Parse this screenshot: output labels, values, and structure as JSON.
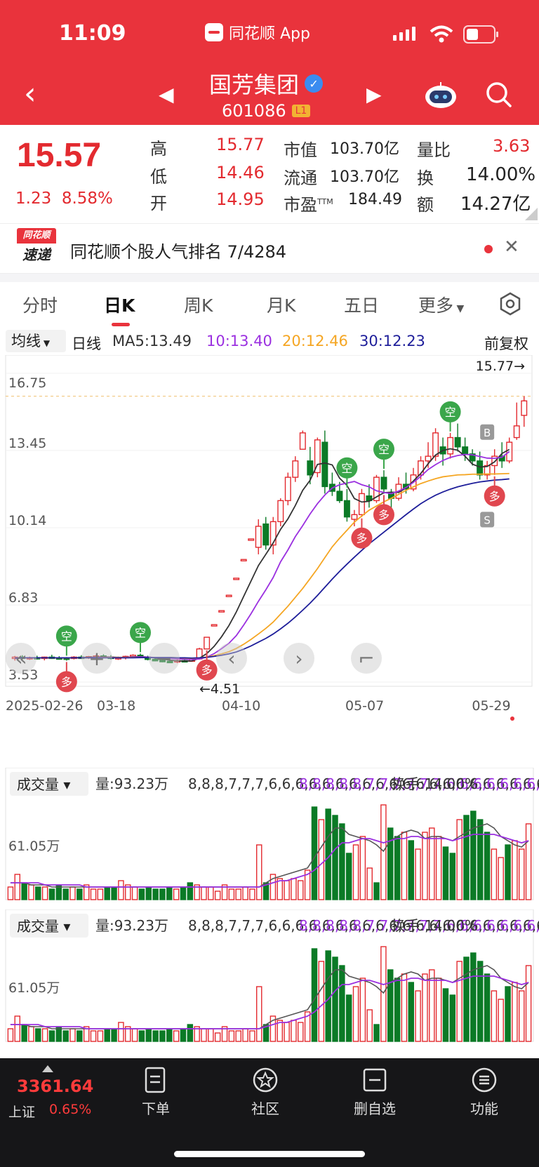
{
  "status_bar": {
    "time": "11:09",
    "app_name": "同花顺 App"
  },
  "header": {
    "stock_name": "国芳集团",
    "stock_code": "601086",
    "level_badge": "L1"
  },
  "quote": {
    "price": "15.57",
    "change": "1.23",
    "change_pct": "8.58%",
    "fields": [
      {
        "label": "高",
        "value": "15.77"
      },
      {
        "label": "低",
        "value": "14.46"
      },
      {
        "label": "开",
        "value": "14.95"
      },
      {
        "label": "市值",
        "value": "103.70亿"
      },
      {
        "label": "流通",
        "value": "103.70亿"
      },
      {
        "label": "市盈",
        "sup": "TTM",
        "value": "184.49"
      },
      {
        "label": "量比",
        "value": "3.63"
      },
      {
        "label": "换",
        "value": "14.00%"
      },
      {
        "label": "额",
        "value": "14.27亿"
      }
    ]
  },
  "banner": {
    "logo_top": "同花顺",
    "logo_bottom": "速递",
    "text": "同花顺个股人气排名 7/4284"
  },
  "tabs": [
    "分时",
    "日K",
    "周K",
    "月K",
    "五日",
    "更多"
  ],
  "ma_row": {
    "selector": "均线",
    "period": "日线",
    "ma5": "MA5:13.49",
    "ma10": "10:13.40",
    "ma20": "20:12.46",
    "ma30": "30:12.23",
    "adjust": "前复权"
  },
  "colors": {
    "up": "#e32a2f",
    "down": "#0b7a26",
    "ma5": "#333333",
    "ma10": "#9b30e0",
    "ma20": "#f5a623",
    "ma30": "#1e1e9a",
    "header_bg": "#e9333c"
  },
  "chart_data": {
    "type": "candlestick",
    "y_ticks": [
      "16.75",
      "13.45",
      "10.14",
      "6.83",
      "3.53"
    ],
    "x_ticks": [
      "2025-02-26",
      "03-18",
      "04-10",
      "05-07",
      "05-29"
    ],
    "ylim": [
      3.53,
      16.75
    ],
    "high_label": "15.77→",
    "low_label": "←4.51",
    "candles": [
      {
        "o": 4.55,
        "h": 4.65,
        "l": 4.45,
        "c": 4.6
      },
      {
        "o": 4.6,
        "h": 4.68,
        "l": 4.5,
        "c": 4.55
      },
      {
        "o": 4.55,
        "h": 4.62,
        "l": 4.48,
        "c": 4.58
      },
      {
        "o": 4.58,
        "h": 4.66,
        "l": 4.5,
        "c": 4.54
      },
      {
        "o": 4.54,
        "h": 4.62,
        "l": 4.46,
        "c": 4.6
      },
      {
        "o": 4.6,
        "h": 4.7,
        "l": 4.52,
        "c": 4.57
      },
      {
        "o": 4.57,
        "h": 4.64,
        "l": 4.49,
        "c": 4.56
      },
      {
        "o": 4.56,
        "h": 4.6,
        "l": 4.45,
        "c": 4.55
      },
      {
        "o": 4.55,
        "h": 4.64,
        "l": 4.5,
        "c": 4.6
      },
      {
        "o": 4.6,
        "h": 4.68,
        "l": 4.52,
        "c": 4.58
      },
      {
        "o": 4.58,
        "h": 4.65,
        "l": 4.52,
        "c": 4.62
      },
      {
        "o": 4.62,
        "h": 4.7,
        "l": 4.55,
        "c": 4.65
      },
      {
        "o": 4.65,
        "h": 4.72,
        "l": 4.55,
        "c": 4.6
      },
      {
        "o": 4.6,
        "h": 4.68,
        "l": 4.5,
        "c": 4.55
      },
      {
        "o": 4.55,
        "h": 4.62,
        "l": 4.48,
        "c": 4.58
      },
      {
        "o": 4.58,
        "h": 4.66,
        "l": 4.5,
        "c": 4.63
      },
      {
        "o": 4.63,
        "h": 4.72,
        "l": 4.56,
        "c": 4.68
      },
      {
        "o": 4.68,
        "h": 4.75,
        "l": 4.55,
        "c": 4.6
      },
      {
        "o": 4.6,
        "h": 4.66,
        "l": 4.46,
        "c": 4.5
      },
      {
        "o": 4.5,
        "h": 4.58,
        "l": 4.42,
        "c": 4.46
      },
      {
        "o": 4.46,
        "h": 4.55,
        "l": 4.38,
        "c": 4.42
      },
      {
        "o": 4.42,
        "h": 4.5,
        "l": 4.35,
        "c": 4.4
      },
      {
        "o": 4.4,
        "h": 4.5,
        "l": 4.34,
        "c": 4.45
      },
      {
        "o": 4.45,
        "h": 4.55,
        "l": 4.38,
        "c": 4.42
      },
      {
        "o": 4.42,
        "h": 4.55,
        "l": 4.4,
        "c": 4.52
      },
      {
        "o": 4.52,
        "h": 5.0,
        "l": 4.51,
        "c": 4.95
      },
      {
        "o": 4.95,
        "h": 5.45,
        "l": 4.95,
        "c": 5.45
      },
      {
        "o": 5.99,
        "h": 5.99,
        "l": 5.99,
        "c": 5.99
      },
      {
        "o": 6.59,
        "h": 6.59,
        "l": 6.59,
        "c": 6.59
      },
      {
        "o": 7.25,
        "h": 7.25,
        "l": 7.25,
        "c": 7.25
      },
      {
        "o": 7.98,
        "h": 7.98,
        "l": 7.98,
        "c": 7.98
      },
      {
        "o": 8.78,
        "h": 8.78,
        "l": 8.78,
        "c": 8.78
      },
      {
        "o": 9.66,
        "h": 9.66,
        "l": 9.66,
        "c": 9.66
      },
      {
        "o": 9.3,
        "h": 10.5,
        "l": 9.0,
        "c": 10.2
      },
      {
        "o": 10.3,
        "h": 10.6,
        "l": 9.2,
        "c": 9.4
      },
      {
        "o": 9.4,
        "h": 10.6,
        "l": 9.0,
        "c": 10.4
      },
      {
        "o": 10.4,
        "h": 11.4,
        "l": 10.2,
        "c": 11.3
      },
      {
        "o": 11.3,
        "h": 12.5,
        "l": 11.1,
        "c": 12.3
      },
      {
        "o": 12.3,
        "h": 13.2,
        "l": 12.1,
        "c": 13.0
      },
      {
        "o": 13.5,
        "h": 14.3,
        "l": 13.5,
        "c": 14.2
      },
      {
        "o": 13.0,
        "h": 13.6,
        "l": 12.0,
        "c": 12.4
      },
      {
        "o": 12.5,
        "h": 14.0,
        "l": 12.3,
        "c": 13.9
      },
      {
        "o": 13.8,
        "h": 14.3,
        "l": 11.6,
        "c": 11.9
      },
      {
        "o": 12.0,
        "h": 12.5,
        "l": 11.5,
        "c": 11.7
      },
      {
        "o": 11.7,
        "h": 12.1,
        "l": 11.2,
        "c": 11.3
      },
      {
        "o": 11.3,
        "h": 11.8,
        "l": 10.4,
        "c": 10.6
      },
      {
        "o": 10.5,
        "h": 10.9,
        "l": 10.2,
        "c": 10.7
      },
      {
        "o": 10.7,
        "h": 11.8,
        "l": 10.6,
        "c": 11.6
      },
      {
        "o": 11.5,
        "h": 12.0,
        "l": 11.0,
        "c": 11.3
      },
      {
        "o": 11.3,
        "h": 12.4,
        "l": 11.2,
        "c": 12.3
      },
      {
        "o": 12.3,
        "h": 12.6,
        "l": 11.6,
        "c": 11.8
      },
      {
        "o": 11.6,
        "h": 11.8,
        "l": 10.9,
        "c": 11.4
      },
      {
        "o": 11.4,
        "h": 12.3,
        "l": 11.3,
        "c": 12.0
      },
      {
        "o": 12.0,
        "h": 12.5,
        "l": 11.6,
        "c": 11.8
      },
      {
        "o": 11.8,
        "h": 12.7,
        "l": 11.7,
        "c": 12.4
      },
      {
        "o": 12.4,
        "h": 13.2,
        "l": 12.2,
        "c": 13.0
      },
      {
        "o": 13.0,
        "h": 13.8,
        "l": 12.7,
        "c": 13.2
      },
      {
        "o": 13.2,
        "h": 14.4,
        "l": 13.0,
        "c": 14.2
      },
      {
        "o": 13.6,
        "h": 14.0,
        "l": 12.8,
        "c": 13.3
      },
      {
        "o": 13.3,
        "h": 14.2,
        "l": 13.1,
        "c": 14.0
      },
      {
        "o": 14.0,
        "h": 14.6,
        "l": 13.4,
        "c": 13.6
      },
      {
        "o": 13.6,
        "h": 14.0,
        "l": 13.0,
        "c": 13.3
      },
      {
        "o": 13.3,
        "h": 13.5,
        "l": 12.8,
        "c": 13.0
      },
      {
        "o": 13.0,
        "h": 13.4,
        "l": 12.2,
        "c": 12.4
      },
      {
        "o": 12.4,
        "h": 13.0,
        "l": 12.2,
        "c": 12.8
      },
      {
        "o": 12.8,
        "h": 13.5,
        "l": 12.4,
        "c": 13.2
      },
      {
        "o": 13.2,
        "h": 13.8,
        "l": 12.7,
        "c": 13.0
      },
      {
        "o": 13.0,
        "h": 14.0,
        "l": 12.9,
        "c": 13.8
      },
      {
        "o": 14.0,
        "h": 15.5,
        "l": 13.9,
        "c": 14.5
      },
      {
        "o": 14.95,
        "h": 15.77,
        "l": 14.46,
        "c": 15.57
      }
    ],
    "ma5": [
      4.56,
      4.57,
      4.57,
      4.57,
      4.57,
      4.57,
      4.57,
      4.56,
      4.57,
      4.58,
      4.59,
      4.6,
      4.61,
      4.6,
      4.59,
      4.59,
      4.61,
      4.62,
      4.6,
      4.56,
      4.52,
      4.47,
      4.44,
      4.43,
      4.44,
      4.55,
      4.75,
      5.06,
      5.47,
      5.95,
      6.53,
      7.2,
      7.86,
      8.52,
      9.0,
      9.49,
      10.07,
      10.52,
      11.09,
      11.74,
      12.17,
      12.85,
      12.91,
      12.83,
      12.26,
      11.95,
      11.39,
      11.24,
      11.27,
      11.46,
      11.64,
      11.66,
      11.65,
      11.84,
      12.14,
      12.46,
      12.88,
      13.25,
      13.45,
      13.52,
      13.46,
      13.2,
      12.86,
      12.74,
      12.76,
      12.96,
      13.32,
      13.49
    ],
    "ma10": [
      4.56,
      4.57,
      4.57,
      4.57,
      4.57,
      4.57,
      4.57,
      4.57,
      4.57,
      4.57,
      4.57,
      4.58,
      4.59,
      4.59,
      4.58,
      4.59,
      4.6,
      4.61,
      4.6,
      4.58,
      4.56,
      4.54,
      4.52,
      4.51,
      4.5,
      4.52,
      4.6,
      4.75,
      4.96,
      5.19,
      5.52,
      5.97,
      6.46,
      6.99,
      7.48,
      8.01,
      8.68,
      9.19,
      9.76,
      10.23,
      10.73,
      11.17,
      11.54,
      11.84,
      11.98,
      12.05,
      12.12,
      11.98,
      11.89,
      11.72,
      11.65,
      11.6,
      11.71,
      11.86,
      12.08,
      12.34,
      12.63,
      12.84,
      13.02,
      13.15,
      13.23,
      13.28,
      13.26,
      13.19,
      13.12,
      13.11,
      13.16,
      13.4
    ],
    "ma20": [
      4.56,
      4.57,
      4.57,
      4.57,
      4.57,
      4.57,
      4.57,
      4.57,
      4.57,
      4.57,
      4.57,
      4.57,
      4.58,
      4.58,
      4.58,
      4.58,
      4.58,
      4.58,
      4.58,
      4.58,
      4.58,
      4.58,
      4.57,
      4.56,
      4.55,
      4.57,
      4.6,
      4.66,
      4.74,
      4.83,
      4.97,
      5.15,
      5.36,
      5.59,
      5.83,
      6.1,
      6.44,
      6.78,
      7.16,
      7.54,
      7.96,
      8.39,
      8.86,
      9.32,
      9.69,
      10.03,
      10.38,
      10.64,
      10.89,
      11.07,
      11.25,
      11.4,
      11.57,
      11.74,
      11.89,
      12.03,
      12.14,
      12.24,
      12.32,
      12.36,
      12.4,
      12.41,
      12.43,
      12.43,
      12.44,
      12.44,
      12.45,
      12.46
    ],
    "ma30": [
      4.56,
      4.57,
      4.57,
      4.57,
      4.57,
      4.57,
      4.57,
      4.57,
      4.57,
      4.57,
      4.57,
      4.57,
      4.57,
      4.57,
      4.57,
      4.57,
      4.57,
      4.58,
      4.58,
      4.58,
      4.58,
      4.58,
      4.57,
      4.57,
      4.56,
      4.57,
      4.59,
      4.63,
      4.68,
      4.74,
      4.82,
      4.94,
      5.08,
      5.24,
      5.4,
      5.59,
      5.81,
      6.05,
      6.32,
      6.61,
      6.91,
      7.24,
      7.59,
      7.94,
      8.27,
      8.58,
      8.88,
      9.17,
      9.45,
      9.7,
      9.95,
      10.2,
      10.45,
      10.7,
      10.94,
      11.17,
      11.36,
      11.53,
      11.67,
      11.79,
      11.89,
      11.97,
      12.04,
      12.1,
      12.14,
      12.18,
      12.2,
      12.23
    ],
    "signals": [
      {
        "i": 7,
        "type": "空"
      },
      {
        "i": 7,
        "type": "多"
      },
      {
        "i": 17,
        "type": "空"
      },
      {
        "i": 26,
        "type": "多"
      },
      {
        "i": 45,
        "type": "空"
      },
      {
        "i": 47,
        "type": "多"
      },
      {
        "i": 50,
        "type": "空"
      },
      {
        "i": 50,
        "type": "多"
      },
      {
        "i": 59,
        "type": "空"
      },
      {
        "i": 65,
        "type": "多"
      },
      {
        "i": 64,
        "type": "B"
      },
      {
        "i": 64,
        "type": "S"
      }
    ],
    "volume": {
      "label": "成交量",
      "vol": "量:93.23万",
      "ma5": [
        8,
        8,
        8,
        7,
        7,
        7,
        6,
        6,
        6,
        6,
        6,
        6,
        6,
        6,
        6,
        6,
        6,
        6,
        6,
        6,
        6,
        6,
        6,
        6,
        6,
        6,
        6,
        6,
        6,
        6,
        6,
        6,
        6,
        6,
        6,
        6,
        6,
        8,
        10,
        11,
        12,
        13,
        14,
        15,
        20,
        25,
        30,
        34,
        34,
        31,
        30,
        29,
        28,
        26,
        23,
        28,
        30,
        32,
        33,
        32,
        29,
        30,
        30,
        29,
        28,
        30,
        32,
        34,
        35,
        36,
        34,
        30,
        28,
        26,
        25,
        28
      ],
      "ma10": [
        8,
        8,
        8,
        8,
        8,
        7,
        7,
        7,
        7,
        7,
        7,
        6,
        6,
        6,
        6,
        6,
        6,
        6,
        6,
        6,
        6,
        6,
        6,
        6,
        6,
        6,
        6,
        6,
        6,
        6,
        6,
        6,
        6,
        6,
        6,
        6,
        6,
        7,
        8,
        9,
        9,
        10,
        11,
        12,
        14,
        17,
        20,
        24,
        27,
        27,
        28,
        29,
        29,
        28,
        27,
        28,
        29,
        29,
        30,
        30,
        29,
        29,
        29,
        29,
        28,
        29,
        30,
        31,
        31,
        31,
        31,
        30,
        29,
        28,
        27,
        28
      ],
      "turnover": "换手:14.00%",
      "y_tick": "61.05万",
      "bars": [
        6,
        12,
        8,
        7,
        6,
        6,
        5,
        7,
        5,
        6,
        5,
        7,
        5,
        5,
        6,
        6,
        9,
        7,
        6,
        5,
        6,
        5,
        5,
        6,
        5,
        6,
        8,
        7,
        6,
        6,
        4,
        7,
        5,
        5,
        6,
        5,
        26,
        8,
        12,
        10,
        9,
        10,
        9,
        14,
        44,
        38,
        43,
        40,
        36,
        22,
        26,
        30,
        15,
        8,
        45,
        34,
        30,
        32,
        28,
        24,
        32,
        34,
        30,
        25,
        22,
        38,
        40,
        42,
        38,
        32,
        24,
        20,
        26,
        28,
        24,
        36
      ]
    }
  },
  "chart_controls": [
    "zoom-out",
    "zoom-in",
    "minus",
    "prev",
    "next",
    "fullscreen"
  ],
  "bottom": {
    "index_value": "3361.64",
    "index_name": "上证",
    "index_pct": "0.65%",
    "items": [
      "下单",
      "社区",
      "删自选",
      "功能"
    ]
  }
}
